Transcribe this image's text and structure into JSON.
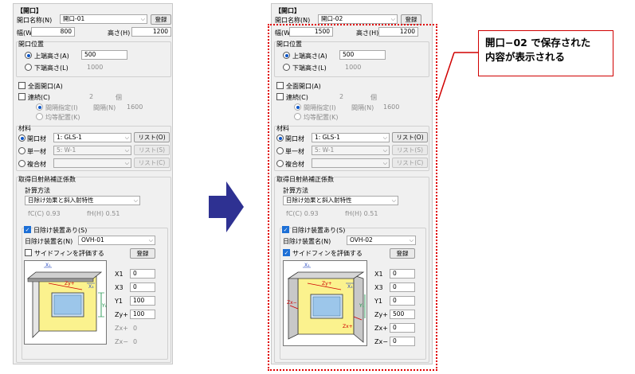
{
  "left": {
    "title": "【開口】",
    "name_label": "開口名称(N)",
    "name_value": "開口-01",
    "register_label": "登録",
    "width_label": "幅(W)",
    "width_value": "800",
    "height_label": "高さ(H)",
    "height_value": "1200",
    "position_title": "開口位置",
    "upper_label": "上端高さ(A)",
    "upper_value": "500",
    "lower_label": "下端高さ(L)",
    "lower_value": "1000",
    "full_label": "全面開口(A)",
    "cont_label": "連続(C)",
    "cont_value": "2",
    "cont_unit": "個",
    "interval_label": "間隔指定(I)",
    "interval_field_label": "間隔(N)",
    "interval_value": "1600",
    "equal_label": "均等配置(K)",
    "material_title": "材料",
    "mat_opening_label": "開口材",
    "mat_opening_value": "1: GLS-1",
    "mat_opening_btn": "リスト(O)",
    "mat_single_label": "単一材",
    "mat_single_value": "5: W-1",
    "mat_single_btn": "リスト(S)",
    "mat_composite_label": "複合材",
    "mat_composite_value": "",
    "mat_composite_btn": "リスト(C)",
    "solar_title": "取得日射熱補正係数",
    "calc_title": "計算方法",
    "calc_value": "日除け効果と斜入射特性",
    "fc_text": "fC(C)  0.93",
    "fh_text": "fH(H)  0.51",
    "shade_chk_label": "日除け装置あり(S)",
    "shade_name_label": "日除け装置名(N)",
    "shade_name_value": "OVH-01",
    "side_fin_label": "サイドフィンを評価する",
    "shade_register": "登録",
    "params": [
      {
        "label": "X1",
        "value": "0"
      },
      {
        "label": "X3",
        "value": "0"
      },
      {
        "label": "Y1",
        "value": "100"
      },
      {
        "label": "Zy+",
        "value": "100"
      },
      {
        "label": "Zx+",
        "value": "0"
      },
      {
        "label": "Zx−",
        "value": "0"
      }
    ],
    "diag": {
      "x1": "X₁",
      "x3": "X₃",
      "y1": "Y₁",
      "zy": "Zy+"
    }
  },
  "right": {
    "title": "【開口】",
    "name_label": "開口名称(N)",
    "name_value": "開口-02",
    "register_label": "登録",
    "width_label": "幅(W)",
    "width_value": "1500",
    "height_label": "高さ(H)",
    "height_value": "1200",
    "position_title": "開口位置",
    "upper_label": "上端高さ(A)",
    "upper_value": "500",
    "lower_label": "下端高さ(L)",
    "lower_value": "1000",
    "full_label": "全面開口(A)",
    "cont_label": "連続(C)",
    "cont_value": "2",
    "cont_unit": "個",
    "interval_label": "間隔指定(I)",
    "interval_field_label": "間隔(N)",
    "interval_value": "1600",
    "equal_label": "均等配置(K)",
    "material_title": "材料",
    "mat_opening_label": "開口材",
    "mat_opening_value": "1: GLS-1",
    "mat_opening_btn": "リスト(O)",
    "mat_single_label": "単一材",
    "mat_single_value": "5: W-1",
    "mat_single_btn": "リスト(S)",
    "mat_composite_label": "複合材",
    "mat_composite_value": "",
    "mat_composite_btn": "リスト(C)",
    "solar_title": "取得日射熱補正係数",
    "calc_title": "計算方法",
    "calc_value": "日除け効果と斜入射特性",
    "fc_text": "fC(C)  0.93",
    "fh_text": "fH(H)  0.51",
    "shade_chk_label": "日除け装置あり(S)",
    "shade_name_label": "日除け装置名(N)",
    "shade_name_value": "OVH-02",
    "side_fin_label": "サイドフィンを評価する",
    "shade_register": "登録",
    "params": [
      {
        "label": "X1",
        "value": "0"
      },
      {
        "label": "X3",
        "value": "0"
      },
      {
        "label": "Y1",
        "value": "0"
      },
      {
        "label": "Zy+",
        "value": "500"
      },
      {
        "label": "Zx+",
        "value": "0"
      },
      {
        "label": "Zx−",
        "value": "0"
      }
    ],
    "diag": {
      "x1": "X₁",
      "x3": "X₃",
      "y1": "Y₁",
      "zy": "Zy+",
      "zxm": "Zx−",
      "zxp": "Zx+"
    }
  },
  "callout": {
    "line1": "開口−02 で保存された",
    "line2": "内容が表示される"
  },
  "colors": {
    "arrow": "#2e3192",
    "highlight": "#e00000",
    "accent": "#0a55c8"
  }
}
